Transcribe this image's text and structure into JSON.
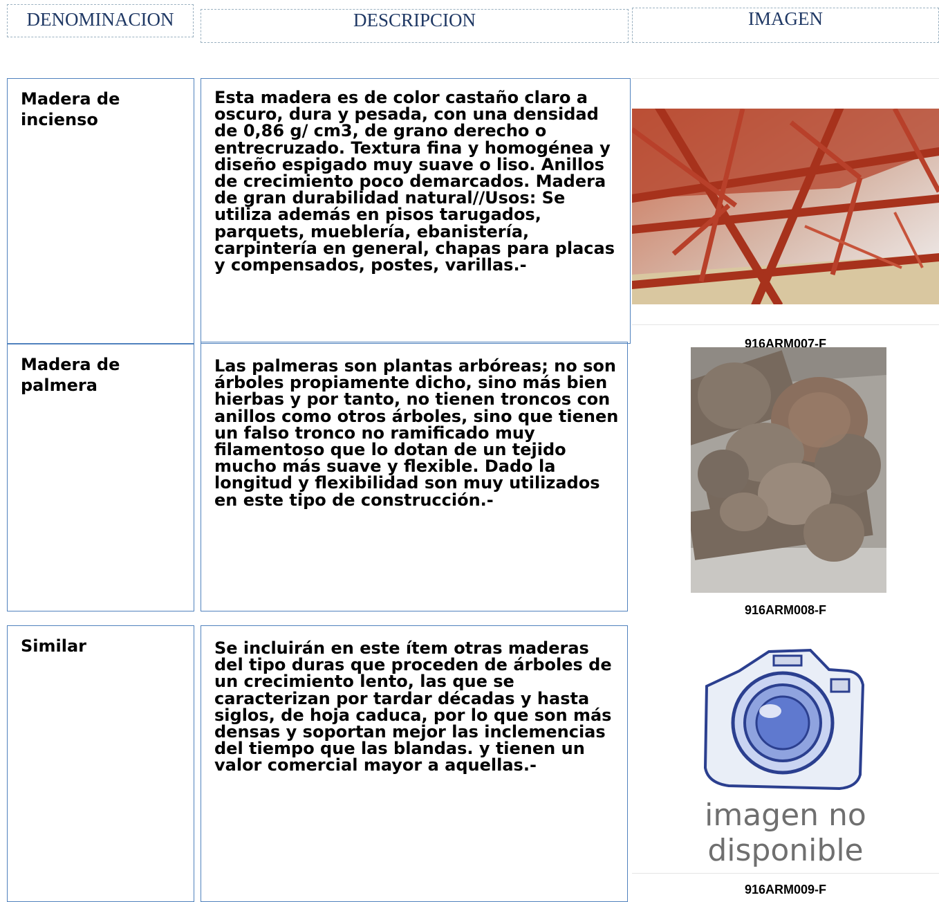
{
  "headers": {
    "denominacion": "DENOMINACION",
    "descripcion": "DESCRIPCION",
    "imagen": "IMAGEN"
  },
  "rows": [
    {
      "name": "Madera de incienso",
      "description": "Esta madera es de color castaño claro a oscuro, dura y pesada, con una densidad de 0,86 g/ cm3, de grano derecho o entrecruzado. Textura fina y homogénea y diseño espigado muy suave o liso. Anillos de crecimiento poco demarcados. Madera de gran durabilidad natural//Usos: Se utiliza además en pisos tarugados, parquets, mueblería, ebanistería, carpintería en general, chapas para placas y compensados, postes, varillas.-",
      "image_code": "916ARM007-F"
    },
    {
      "name": "Madera de palmera",
      "description": "Las palmeras son plantas arbóreas; no son árboles propiamente dicho, sino más bien hierbas y por tanto, no tienen troncos con anillos como otros árboles, sino que tienen un falso tronco no ramificado muy filamentoso que lo dotan de un tejido mucho más suave y flexible. Dado la longitud y flexibilidad son muy utilizados en este tipo de construcción.-",
      "image_code": "916ARM008-F"
    },
    {
      "name": "Similar",
      "description": "Se incluirán en este ítem otras maderas del tipo duras que proceden de árboles de un crecimiento lento, las que se caracterizan por tardar décadas y hasta siglos, de hoja caduca, por lo que son más densas y soportan mejor las inclemencias del tiempo que las blandas. y tienen un valor comercial mayor a aquellas.-",
      "image_code": "916ARM009-F",
      "placeholder_text": [
        "imagen no",
        "disponible"
      ]
    }
  ]
}
